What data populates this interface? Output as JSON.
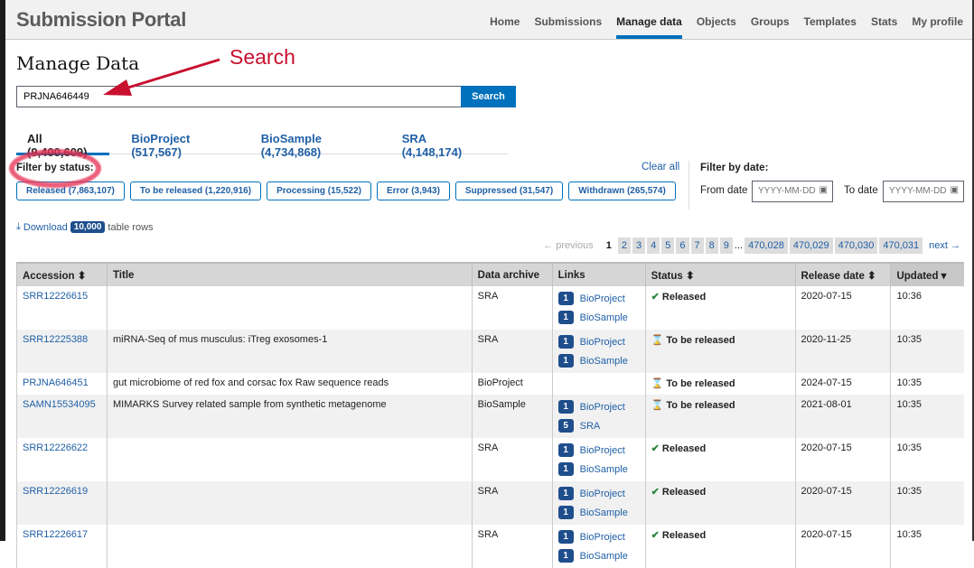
{
  "header": {
    "brand": "Submission Portal",
    "nav": [
      "Home",
      "Submissions",
      "Manage data",
      "Objects",
      "Groups",
      "Templates",
      "Stats",
      "My profile"
    ],
    "active": "Manage data"
  },
  "page_title": "Manage Data",
  "search": {
    "value": "PRJNA646449",
    "button": "Search"
  },
  "annotation": {
    "label": "Search",
    "color": "#c8102e"
  },
  "tabs": [
    "All (9,400,609)",
    "BioProject (517,567)",
    "BioSample (4,734,868)",
    "SRA (4,148,174)"
  ],
  "filter_status": {
    "label": "Filter by status:",
    "clear": "Clear all",
    "chips": [
      "Released (7,863,107)",
      "To be released (1,220,916)",
      "Processing (15,522)",
      "Error (3,943)",
      "Suppressed (31,547)",
      "Withdrawn (265,574)"
    ]
  },
  "filter_date": {
    "label": "Filter by date:",
    "from_label": "From date",
    "to_label": "To date",
    "placeholder": "YYYY-MM-DD"
  },
  "download": {
    "label": "Download",
    "count": "10,000",
    "tail": "table rows"
  },
  "pager": {
    "previous": "← previous",
    "current": "1",
    "pages": [
      "2",
      "3",
      "4",
      "5",
      "6",
      "7",
      "8",
      "9"
    ],
    "ellipsis": "...",
    "last_pages": [
      "470,028",
      "470,029",
      "470,030",
      "470,031"
    ],
    "next": "next →"
  },
  "table": {
    "columns": [
      "Accession ⬍",
      "Title",
      "Data archive",
      "Links",
      "Status ⬍",
      "Release date ⬍",
      "Updated ▾"
    ],
    "rows": [
      {
        "accession": "SRR12226615",
        "title": "",
        "archive": "SRA",
        "links": [
          [
            "1",
            "BioProject"
          ],
          [
            "1",
            "BioSample"
          ]
        ],
        "status": "Released",
        "release": "2020-07-15",
        "updated": "10:36"
      },
      {
        "accession": "SRR12225388",
        "title": "miRNA-Seq of mus musculus: iTreg exosomes-1",
        "archive": "SRA",
        "links": [
          [
            "1",
            "BioProject"
          ],
          [
            "1",
            "BioSample"
          ]
        ],
        "status": "To be released",
        "release": "2020-11-25",
        "updated": "10:35"
      },
      {
        "accession": "PRJNA646451",
        "title": "gut microbiome of red fox and corsac fox Raw sequence reads",
        "archive": "BioProject",
        "links": [],
        "status": "To be released",
        "release": "2024-07-15",
        "updated": "10:35"
      },
      {
        "accession": "SAMN15534095",
        "title": "MIMARKS Survey related sample from synthetic metagenome",
        "archive": "BioSample",
        "links": [
          [
            "1",
            "BioProject"
          ],
          [
            "5",
            "SRA"
          ]
        ],
        "status": "To be released",
        "release": "2021-08-01",
        "updated": "10:35"
      },
      {
        "accession": "SRR12226622",
        "title": "",
        "archive": "SRA",
        "links": [
          [
            "1",
            "BioProject"
          ],
          [
            "1",
            "BioSample"
          ]
        ],
        "status": "Released",
        "release": "2020-07-15",
        "updated": "10:35"
      },
      {
        "accession": "SRR12226619",
        "title": "",
        "archive": "SRA",
        "links": [
          [
            "1",
            "BioProject"
          ],
          [
            "1",
            "BioSample"
          ]
        ],
        "status": "Released",
        "release": "2020-07-15",
        "updated": "10:35"
      },
      {
        "accession": "SRR12226617",
        "title": "",
        "archive": "SRA",
        "links": [
          [
            "1",
            "BioProject"
          ],
          [
            "1",
            "BioSample"
          ]
        ],
        "status": "Released",
        "release": "2020-07-15",
        "updated": "10:35"
      }
    ]
  }
}
